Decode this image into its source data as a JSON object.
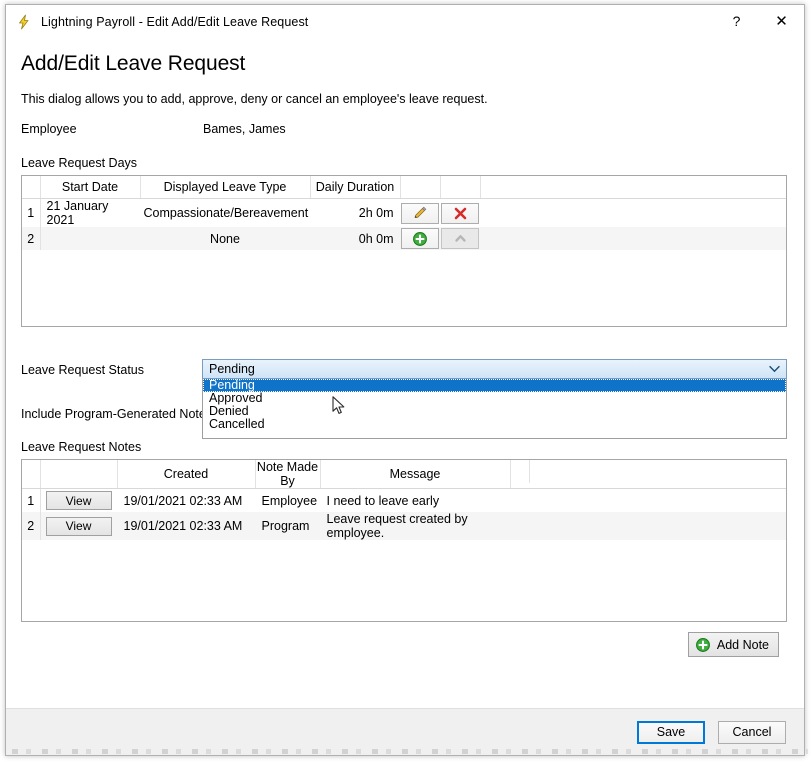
{
  "window": {
    "title": "Lightning Payroll - Edit Add/Edit Leave Request",
    "app_icon": "lightning-bolt-icon",
    "help_label": "?",
    "close_label": "✕"
  },
  "page": {
    "title": "Add/Edit Leave Request",
    "subtitle": "This dialog allows you to add, approve, deny or cancel an employee's leave request."
  },
  "employee": {
    "label": "Employee",
    "value": "Bames, James"
  },
  "days_section": {
    "label": "Leave Request Days",
    "columns": [
      "",
      "Start Date",
      "Displayed Leave Type",
      "Daily Duration",
      "",
      ""
    ],
    "rows": [
      {
        "num": "1",
        "start_date": "21 January 2021",
        "leave_type": "Compassionate/Bereavement",
        "duration": "2h 0m",
        "action1": "edit-pencil-icon",
        "action2": "delete-cross-icon"
      },
      {
        "num": "2",
        "start_date": "",
        "leave_type": "None",
        "duration": "0h 0m",
        "action1": "add-plus-icon",
        "action2": "collapse-chevron-up-icon"
      }
    ]
  },
  "status": {
    "label": "Leave Request Status",
    "selected": "Pending",
    "options": [
      "Pending",
      "Approved",
      "Denied",
      "Cancelled"
    ],
    "highlight_color": "#1073ca"
  },
  "program_notes": {
    "label": "Include Program-Generated Notes?"
  },
  "notes_section": {
    "label": "Leave Request Notes",
    "columns": [
      "",
      "",
      "Created",
      "Note Made By",
      "Message",
      ""
    ],
    "view_label": "View",
    "rows": [
      {
        "num": "1",
        "view": "View",
        "created": "19/01/2021 02:33 AM",
        "made_by": "Employee",
        "message": "I need to leave early"
      },
      {
        "num": "2",
        "view": "View",
        "created": "19/01/2021 02:33 AM",
        "made_by": "Program",
        "message": "Leave request created by employee."
      }
    ]
  },
  "add_note": {
    "label": "Add Note",
    "icon": "add-plus-icon"
  },
  "footer": {
    "save_label": "Save",
    "cancel_label": "Cancel",
    "focus_color": "#0078d7"
  }
}
